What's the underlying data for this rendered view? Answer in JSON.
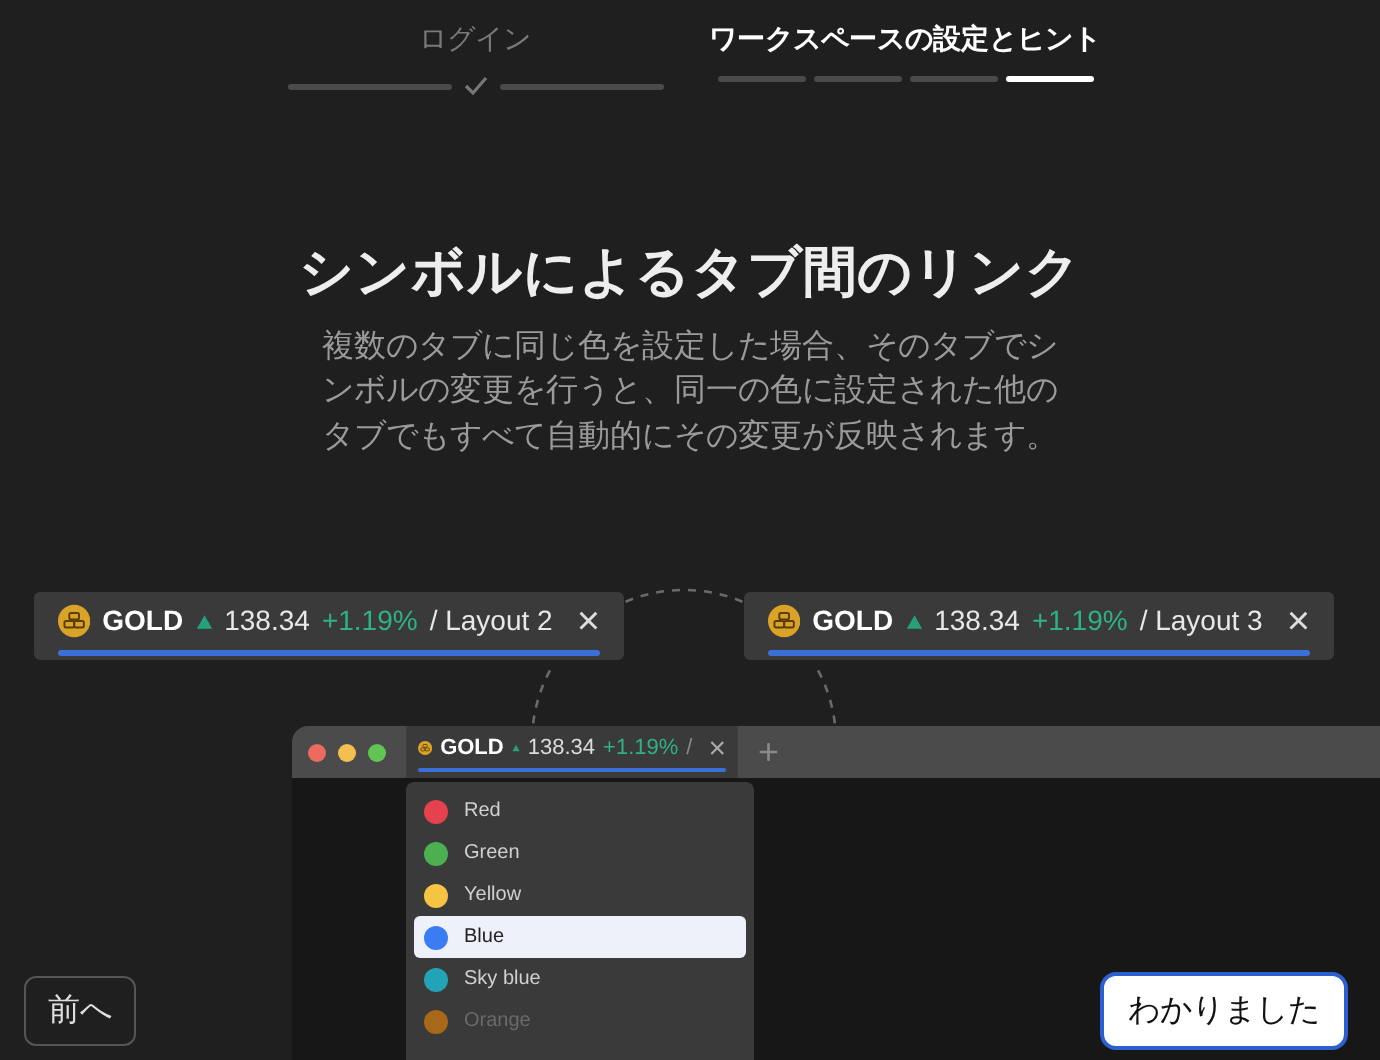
{
  "steps": [
    {
      "label": "ログイン",
      "selected": false,
      "done": true,
      "segments": [
        {
          "selected": false
        },
        {
          "selected": false
        }
      ]
    },
    {
      "label": "ワークスペースの設定とヒント",
      "selected": true,
      "done": false,
      "segments": [
        {
          "selected": false
        },
        {
          "selected": false
        },
        {
          "selected": false
        },
        {
          "selected": true
        }
      ]
    }
  ],
  "title": "シンボルによるタブ間のリンク",
  "description": "複数のタブに同じ色を設定した場合、そのタブでシンボルの変更を行うと、同一の色に設定された他のタブでもすべて自動的にその変更が反映されます。",
  "linked_tabs": [
    {
      "symbol": "GOLD",
      "price": "138.34",
      "change": "+1.19%",
      "layout": "/ Layout 2",
      "close": "×",
      "color": "#3b6fd8"
    },
    {
      "symbol": "GOLD",
      "price": "138.34",
      "change": "+1.19%",
      "layout": "/ Layout 3",
      "close": "×",
      "color": "#3b6fd8"
    }
  ],
  "app_window": {
    "tab": {
      "symbol": "GOLD",
      "price": "138.34",
      "change": "+1.19%",
      "layout": "/",
      "close": "×",
      "color": "#3b6fd8"
    },
    "new_tab": "+",
    "color_menu": [
      {
        "label": "Red",
        "color": "#e5424d",
        "selected": false,
        "dimmed": false
      },
      {
        "label": "Green",
        "color": "#4caf50",
        "selected": false,
        "dimmed": false
      },
      {
        "label": "Yellow",
        "color": "#f6c343",
        "selected": false,
        "dimmed": false
      },
      {
        "label": "Blue",
        "color": "#3b7cf4",
        "selected": true,
        "dimmed": false
      },
      {
        "label": "Sky blue",
        "color": "#22a3b8",
        "selected": false,
        "dimmed": false
      },
      {
        "label": "Orange",
        "color": "#a8681a",
        "selected": false,
        "dimmed": true
      }
    ]
  },
  "back_button": "前へ",
  "done_button": "わかりました"
}
